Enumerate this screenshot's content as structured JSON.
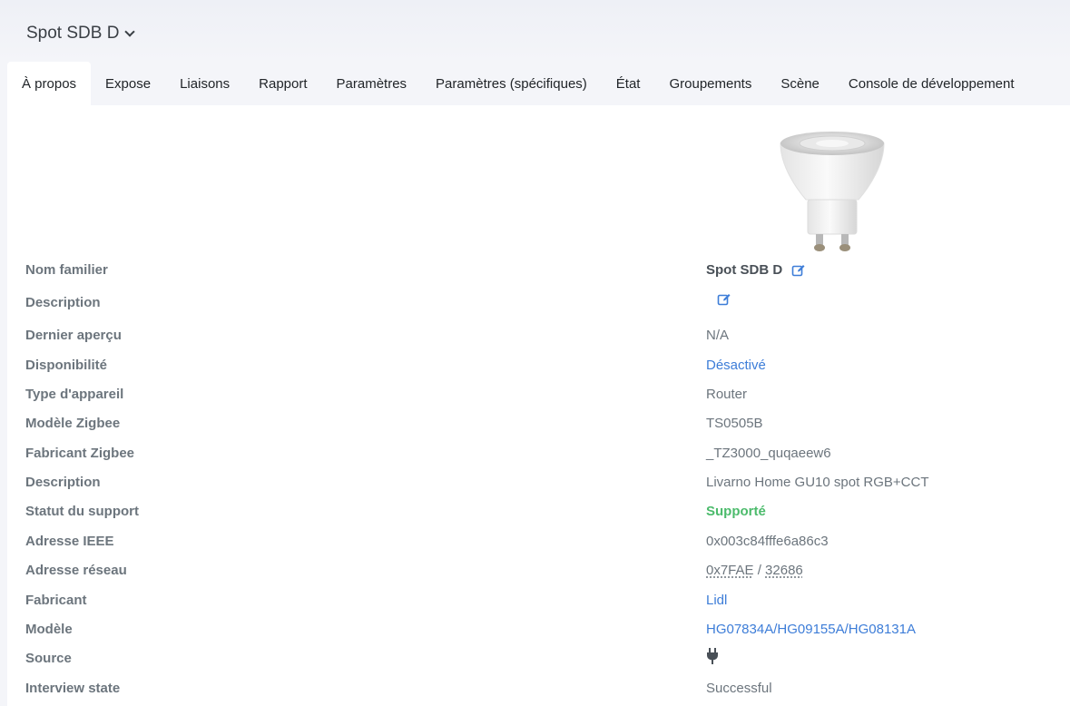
{
  "header": {
    "device_name": "Spot SDB D"
  },
  "tabs": [
    {
      "label": "À propos"
    },
    {
      "label": "Expose"
    },
    {
      "label": "Liaisons"
    },
    {
      "label": "Rapport"
    },
    {
      "label": "Paramètres"
    },
    {
      "label": "Paramètres (spécifiques)"
    },
    {
      "label": "État"
    },
    {
      "label": "Groupements"
    },
    {
      "label": "Scène"
    },
    {
      "label": "Console de développement"
    }
  ],
  "active_tab": "À propos",
  "about": {
    "friendly_name": {
      "label": "Nom familier",
      "value": "Spot SDB D"
    },
    "description_edit": {
      "label": "Description"
    },
    "last_seen": {
      "label": "Dernier aperçu",
      "value": "N/A"
    },
    "availability": {
      "label": "Disponibilité",
      "value": "Désactivé"
    },
    "device_type": {
      "label": "Type d'appareil",
      "value": "Router"
    },
    "zigbee_model": {
      "label": "Modèle Zigbee",
      "value": "TS0505B"
    },
    "zigbee_manufacturer": {
      "label": "Fabricant Zigbee",
      "value": "_TZ3000_quqaeew6"
    },
    "description": {
      "label": "Description",
      "value": "Livarno Home GU10 spot RGB+CCT"
    },
    "support_status": {
      "label": "Statut du support",
      "value": "Supporté"
    },
    "ieee_address": {
      "label": "Adresse IEEE",
      "value": "0x003c84fffe6a86c3"
    },
    "network_address": {
      "label": "Adresse réseau",
      "hex": "0x7FAE",
      "separator": " / ",
      "dec": "32686"
    },
    "manufacturer": {
      "label": "Fabricant",
      "value": "Lidl"
    },
    "model": {
      "label": "Modèle",
      "value": "HG07834A/HG09155A/HG08131A"
    },
    "source": {
      "label": "Source",
      "icon": "plug-icon"
    },
    "interview_state": {
      "label": "Interview state",
      "value": "Successful"
    }
  },
  "colors": {
    "link": "#3d7dd8",
    "success": "#4cbb6c",
    "muted": "#6c757d"
  }
}
